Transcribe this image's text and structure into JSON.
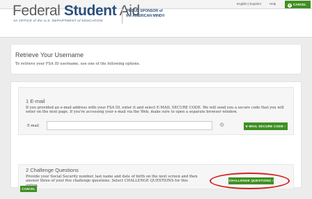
{
  "topbar": {
    "lang_label": "English | Español",
    "help_label": "Help",
    "cancel_label": "CANCEL"
  },
  "header": {
    "logo_light": "Federal",
    "logo_bold": "Student",
    "logo_end": "Aid",
    "logo_sub": "An OFFICE of the U.S. DEPARTMENT of EDUCATION",
    "sponsor_line1": "PROUD SPONSOR of",
    "sponsor_line2": "the AMERICAN MIND®"
  },
  "page": {
    "title": "Retrieve Your Username",
    "intro": "To retrieve your FSA ID username, use one of the following options."
  },
  "email_section": {
    "heading": "1 E-mail",
    "text": "If you provided an e-mail address with your FSA ID, enter it and select E-MAIL SECURE CODE. We will send you a secure code that you will enter on the next page. If you're accessing your e-mail via the Web, make sure to open a separate browser window.",
    "field_label": "E-mail",
    "field_value": "",
    "button_label": "E-MAIL SECURE CODE ›"
  },
  "challenge_section": {
    "heading": "2 Challenge Questions",
    "text": "Provide your Social Security number, last name and date of birth on the next screen and then answer three of your five challenge questions. Select CHALLENGE QUESTIONS for this option.",
    "button_label": "CHALLENGE QUESTIONS ›"
  },
  "footer": {
    "cancel_label": "CANCEL"
  },
  "colors": {
    "accent_green": "#3f8f22",
    "brand_blue": "#2c4f7c",
    "highlight_red": "#d21f1f"
  }
}
